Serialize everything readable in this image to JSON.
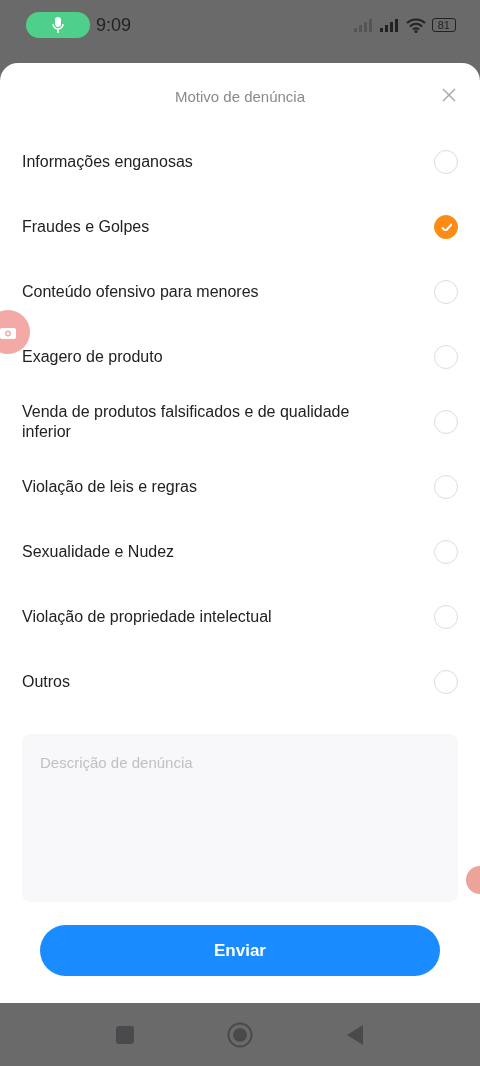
{
  "status_bar": {
    "time": "9:09",
    "battery": "81"
  },
  "sheet": {
    "title": "Motivo de denúncia"
  },
  "reasons": [
    {
      "label": "Informações enganosas",
      "selected": false
    },
    {
      "label": "Fraudes e Golpes",
      "selected": true
    },
    {
      "label": "Conteúdo ofensivo para menores",
      "selected": false
    },
    {
      "label": "Exagero de produto",
      "selected": false
    },
    {
      "label": "Venda de produtos falsificados e de qualidade inferior",
      "selected": false
    },
    {
      "label": "Violação de leis e regras",
      "selected": false
    },
    {
      "label": "Sexualidade e Nudez",
      "selected": false
    },
    {
      "label": "Violação de propriedade intelectual",
      "selected": false
    },
    {
      "label": "Outros",
      "selected": false
    }
  ],
  "description": {
    "placeholder": "Descrição de denúncia"
  },
  "submit_button": {
    "label": "Enviar"
  }
}
